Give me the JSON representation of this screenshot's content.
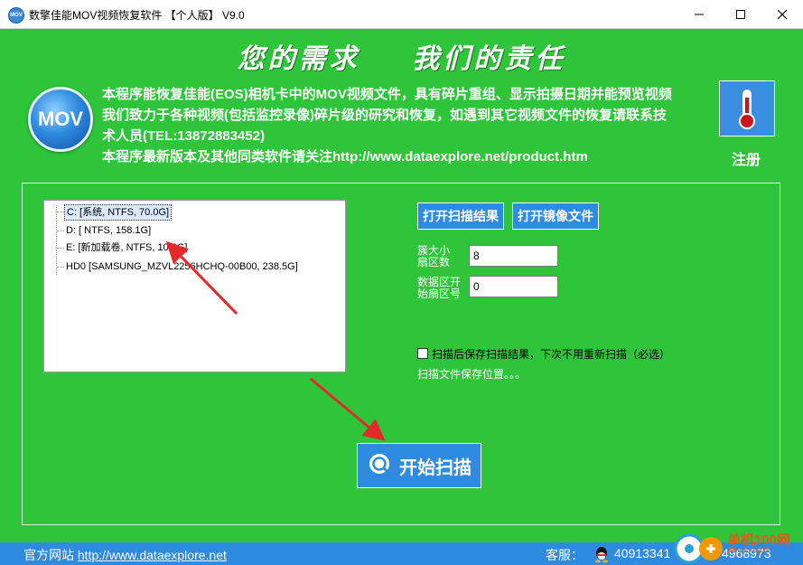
{
  "window": {
    "title": "数擎佳能MOV视频恢复软件 【个人版】 V9.0",
    "icon_label": "MOV"
  },
  "header": {
    "slogan": "您的需求    我们的责任",
    "logo_text": "MOV",
    "description": [
      "本程序能恢复佳能(EOS)相机卡中的MOV视频文件，具有碎片重组、显示拍摄日期并能预览视频",
      "我们致力于各种视频(包括监控录像)碎片级的研究和恢复，如遇到其它视频文件的恢复请联系技",
      "术人员(TEL:13872883452)",
      "本程序最新版本及其他同类软件请关注http://www.dataexplore.net/product.htm"
    ],
    "register_label": "注册"
  },
  "drives": [
    {
      "label": "C: [系统, NTFS, 70.0G]",
      "selected": true
    },
    {
      "label": "D: [ NTFS, 158.1G]",
      "selected": false
    },
    {
      "label": "E: [新加载卷, NTFS, 10.0G]",
      "selected": false
    },
    {
      "label": "HD0  [SAMSUNG_MZVL2256HCHQ-00B00, 238.5G]",
      "selected": false
    }
  ],
  "controls": {
    "open_scan_result": "打开扫描结果",
    "open_image_file": "打开镜像文件",
    "cluster_label": "簇大小\n扇区数",
    "cluster_value": "8",
    "data_start_label": "数据区开\n始扇区号",
    "data_start_value": "0",
    "save_checkbox_label": "扫描后保存扫描结果，下次不用重新扫描（必选）",
    "save_location": "扫描文件保存位置。。。",
    "start_scan": "开始扫描"
  },
  "statusbar": {
    "site_prefix": "官方网站",
    "site_url": "http://www.dataexplore.net",
    "service_label": "客服：",
    "qq1": "40913341",
    "qq2": "4968973"
  },
  "watermark": {
    "text": "单机100网",
    "sub": "danji100.com"
  },
  "colors": {
    "background": "#2ec53a",
    "accent": "#2f8be0"
  }
}
